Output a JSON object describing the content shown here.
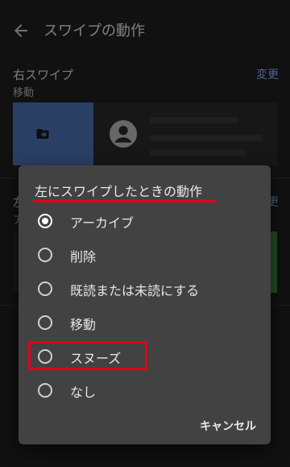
{
  "header": {
    "title": "スワイプの動作"
  },
  "right_swipe": {
    "title": "右スワイプ",
    "action": "移動",
    "change_label": "変更"
  },
  "left_swipe": {
    "title_peek": "左",
    "action_peek": "ア",
    "change_peek": "更"
  },
  "dialog": {
    "title": "左にスワイプしたときの動作",
    "options": [
      {
        "label": "アーカイブ",
        "selected": true
      },
      {
        "label": "削除",
        "selected": false
      },
      {
        "label": "既読または未読にする",
        "selected": false
      },
      {
        "label": "移動",
        "selected": false
      },
      {
        "label": "スヌーズ",
        "selected": false
      },
      {
        "label": "なし",
        "selected": false
      }
    ],
    "cancel_label": "キャンセル"
  },
  "colors": {
    "background": "#1f1f1f",
    "dialog": "#424242",
    "accent_link": "#8ab4f8",
    "swipe_blue": "#4b74b7",
    "annotation_red": "#e0001b"
  }
}
